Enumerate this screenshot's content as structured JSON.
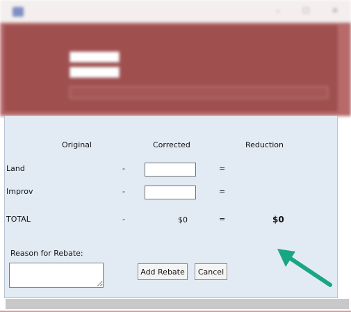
{
  "colors": {
    "dialog_background": "#e2eaf3",
    "blurred_window_header": "#a04f4f",
    "arrow": "#1aa585"
  },
  "columns": {
    "original": "Original",
    "corrected": "Corrected",
    "reduction": "Reduction"
  },
  "rows": {
    "land": {
      "label": "Land",
      "minus": "-",
      "equals": "="
    },
    "improv": {
      "label": "Improv",
      "minus": "-",
      "equals": "="
    },
    "total": {
      "label": "TOTAL",
      "minus": "-",
      "corrected_value": "$0",
      "equals": "=",
      "reduction_value": "$0"
    }
  },
  "reason": {
    "label": "Reason for Rebate:",
    "value": ""
  },
  "buttons": {
    "add_rebate": "Add Rebate",
    "cancel": "Cancel"
  },
  "icons": {
    "arrow": "arrow-up-left-icon",
    "app": "app-icon",
    "minimize": "minimize-icon",
    "maximize": "maximize-icon",
    "close": "close-icon"
  }
}
